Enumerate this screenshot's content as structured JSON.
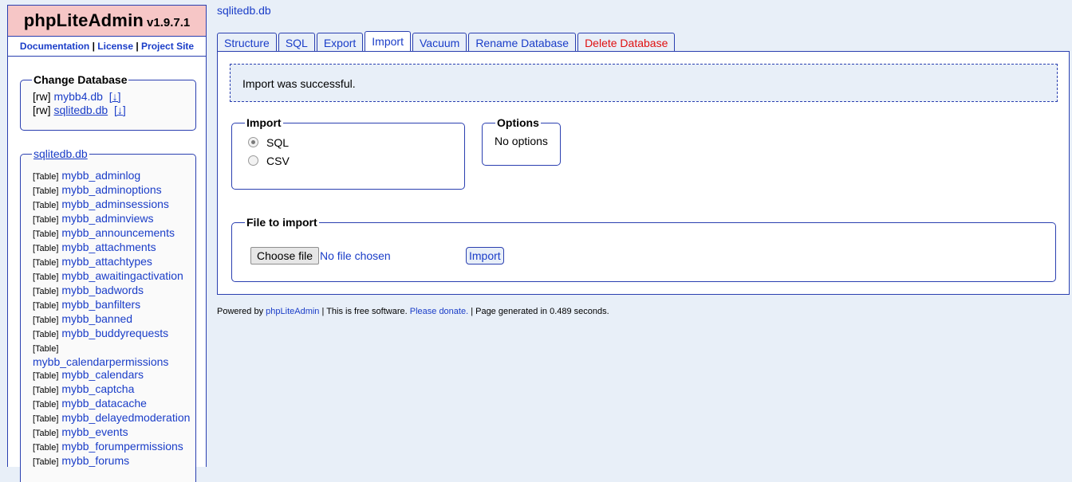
{
  "app": {
    "name": "phpLiteAdmin",
    "version": "v1.9.7.1"
  },
  "sidebar_links": [
    {
      "label": "Documentation"
    },
    {
      "label": "License"
    },
    {
      "label": "Project Site"
    }
  ],
  "change_db": {
    "title": "Change Database",
    "databases": [
      {
        "mode": "[rw]",
        "name": "mybb4.db",
        "download": "[↓]",
        "current": false
      },
      {
        "mode": "[rw]",
        "name": "sqlitedb.db",
        "download": "[↓]",
        "current": true
      }
    ]
  },
  "table_list": {
    "db_name": "sqlitedb.db",
    "tag": "[Table]",
    "tables": [
      "mybb_adminlog",
      "mybb_adminoptions",
      "mybb_adminsessions",
      "mybb_adminviews",
      "mybb_announcements",
      "mybb_attachments",
      "mybb_attachtypes",
      "mybb_awaitingactivation",
      "mybb_badwords",
      "mybb_banfilters",
      "mybb_banned",
      "mybb_buddyrequests",
      "mybb_calendarpermissions",
      "mybb_calendars",
      "mybb_captcha",
      "mybb_datacache",
      "mybb_delayedmoderation",
      "mybb_events",
      "mybb_forumpermissions",
      "mybb_forums"
    ]
  },
  "breadcrumb": "sqlitedb.db",
  "tabs": [
    {
      "label": "Structure",
      "active": false,
      "danger": false
    },
    {
      "label": "SQL",
      "active": false,
      "danger": false
    },
    {
      "label": "Export",
      "active": false,
      "danger": false
    },
    {
      "label": "Import",
      "active": true,
      "danger": false
    },
    {
      "label": "Vacuum",
      "active": false,
      "danger": false
    },
    {
      "label": "Rename Database",
      "active": false,
      "danger": false
    },
    {
      "label": "Delete Database",
      "active": false,
      "danger": true
    }
  ],
  "message": "Import was successful.",
  "import_box": {
    "title": "Import",
    "options": [
      {
        "label": "SQL",
        "selected": true
      },
      {
        "label": "CSV",
        "selected": false
      }
    ]
  },
  "options_box": {
    "title": "Options",
    "text": "No options"
  },
  "file_box": {
    "title": "File to import",
    "choose_label": "Choose file",
    "no_file": "No file chosen",
    "import_label": "Import"
  },
  "footer": {
    "powered_by": "Powered by ",
    "link": "phpLiteAdmin",
    "sep1": " | This is free software. ",
    "donate": "Please donate.",
    "generated": " | Page generated in 0.489 seconds."
  },
  "colors": {
    "accent": "#1a3dc8",
    "border": "#2a3fb0",
    "logo_bg": "#f6c6c6",
    "danger": "#e01010",
    "page_bg": "#e8eff8"
  }
}
